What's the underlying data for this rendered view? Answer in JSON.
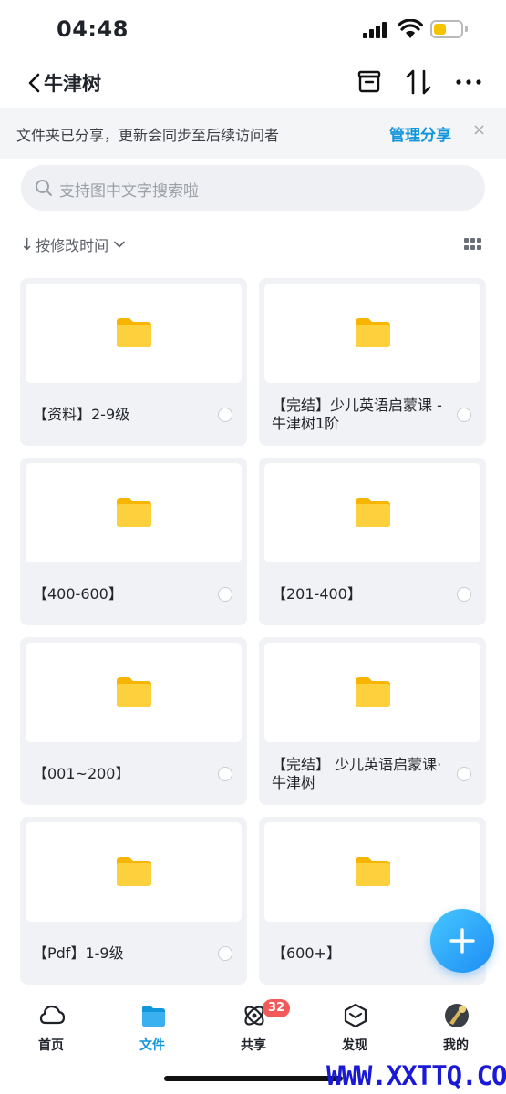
{
  "status_bar": {
    "time": "04:48"
  },
  "nav": {
    "title": "牛津树"
  },
  "share_banner": {
    "text": "文件夹已分享，更新会同步至后续访问者",
    "manage_label": "管理分享",
    "close_glyph": "×"
  },
  "search": {
    "placeholder": "支持图中文字搜索啦"
  },
  "sort": {
    "arrow": "↓",
    "label": "按修改时间"
  },
  "folders": [
    {
      "name": "【资料】2-9级"
    },
    {
      "name": "【完结】少儿英语启蒙课 - 牛津树1阶"
    },
    {
      "name": "【400-600】"
    },
    {
      "name": "【201-400】"
    },
    {
      "name": "【001~200】"
    },
    {
      "name": "【完结】 少儿英语启蒙课·牛津树"
    },
    {
      "name": "【Pdf】1-9级"
    },
    {
      "name": "【600+】"
    }
  ],
  "tabs": [
    {
      "label": "首页",
      "icon": "cloud-home-icon"
    },
    {
      "label": "文件",
      "icon": "folder-icon",
      "active": true
    },
    {
      "label": "共享",
      "icon": "share-orbit-icon",
      "badge": "32"
    },
    {
      "label": "发现",
      "icon": "discover-cube-icon"
    },
    {
      "label": "我的",
      "icon": "avatar"
    }
  ],
  "watermark": "WWW.XXTTQ.COM",
  "colors": {
    "accent": "#1296db",
    "folder": "#f9c319",
    "badge": "#f25a5a",
    "banner_bg": "#f4f5f7"
  }
}
